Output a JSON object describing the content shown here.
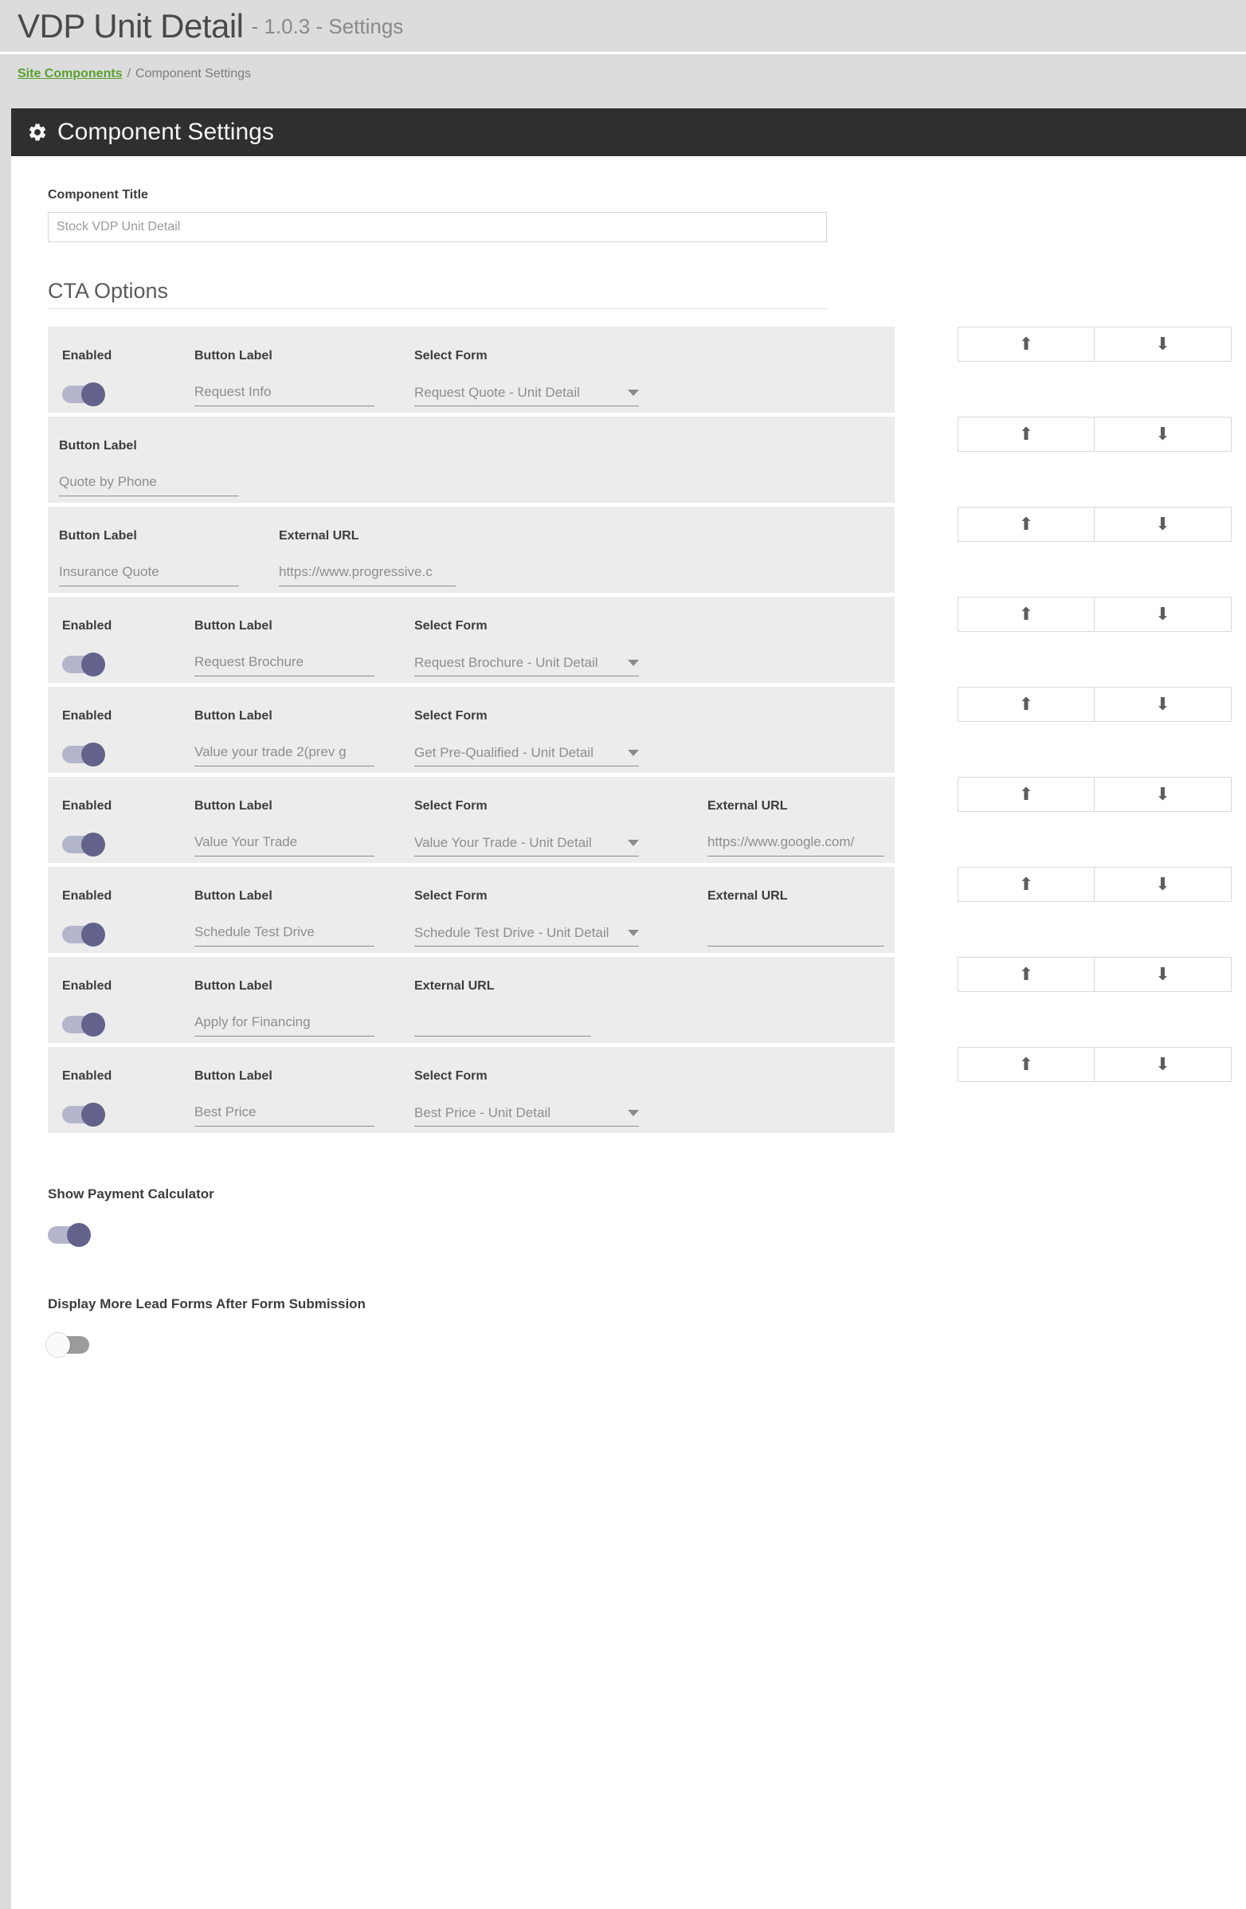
{
  "header": {
    "title": "VDP Unit Detail",
    "version": "- 1.0.3 - Settings"
  },
  "breadcrumb": {
    "root": "Site Components",
    "separator": "/",
    "current": "Component Settings"
  },
  "panel": {
    "icon": "gear-icon",
    "title": "Component Settings"
  },
  "component_title": {
    "label": "Component Title",
    "value": "Stock VDP Unit Detail"
  },
  "cta_section": {
    "title": "CTA Options",
    "column_headers": {
      "enabled": "Enabled",
      "button_label": "Button Label",
      "select_form": "Select Form",
      "external_url": "External URL"
    },
    "order_buttons": {
      "up": "⬆",
      "down": "⬇"
    },
    "rows": [
      {
        "has_enabled": true,
        "enabled": true,
        "button_label": "Request Info",
        "has_form": true,
        "select_form": "Request Quote - Unit Detail",
        "has_url": false,
        "external_url": ""
      },
      {
        "has_enabled": false,
        "enabled": false,
        "button_label": "Quote by Phone",
        "has_form": false,
        "select_form": "",
        "has_url": false,
        "external_url": ""
      },
      {
        "has_enabled": false,
        "enabled": false,
        "button_label": "Insurance Quote",
        "has_form": false,
        "select_form": "",
        "has_url": true,
        "external_url": "https://www.progressive.c"
      },
      {
        "has_enabled": true,
        "enabled": true,
        "button_label": "Request Brochure",
        "has_form": true,
        "select_form": "Request Brochure - Unit Detail",
        "has_url": false,
        "external_url": ""
      },
      {
        "has_enabled": true,
        "enabled": true,
        "button_label": "Value your trade 2(prev g",
        "has_form": true,
        "select_form": "Get Pre-Qualified - Unit Detail",
        "has_url": false,
        "external_url": ""
      },
      {
        "has_enabled": true,
        "enabled": true,
        "button_label": "Value Your Trade",
        "has_form": true,
        "select_form": "Value Your Trade - Unit Detail",
        "has_url": true,
        "external_url": "https://www.google.com/"
      },
      {
        "has_enabled": true,
        "enabled": true,
        "button_label": "Schedule Test Drive",
        "has_form": true,
        "select_form": "Schedule Test Drive - Unit Detail",
        "has_url": true,
        "external_url": ""
      },
      {
        "has_enabled": true,
        "enabled": true,
        "button_label": "Apply for Financing",
        "has_form": false,
        "select_form": "",
        "has_url": true,
        "external_url": ""
      },
      {
        "has_enabled": true,
        "enabled": true,
        "button_label": "Best Price",
        "has_form": true,
        "select_form": "Best Price - Unit Detail",
        "has_url": false,
        "external_url": ""
      }
    ]
  },
  "bottom_settings": [
    {
      "label": "Show Payment Calculator",
      "enabled": true
    },
    {
      "label": "Display More Lead Forms After Form Submission",
      "enabled": false
    }
  ],
  "colors": {
    "breadcrumb_link": "#5a9f2e",
    "panel_header_bg": "#302f2f",
    "toggle_on_track": "#b3b5cb",
    "toggle_on_knob": "#62628b",
    "toggle_off_track": "#9b9b9b",
    "card_bg": "#ececec",
    "page_bg": "#dcdcdc"
  }
}
